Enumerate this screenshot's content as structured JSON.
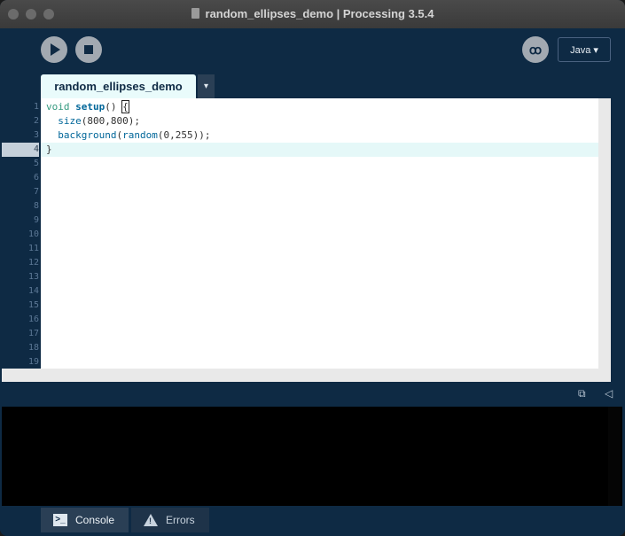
{
  "window": {
    "title": "random_ellipses_demo | Processing 3.5.4"
  },
  "toolbar": {
    "run_icon": "play-icon",
    "stop_icon": "stop-icon",
    "debug_icon": "butterfly-icon",
    "mode_label": "Java ▾"
  },
  "tabs": [
    {
      "label": "random_ellipses_demo"
    }
  ],
  "tab_menu": "▾",
  "editor": {
    "line_numbers": [
      "1",
      "2",
      "3",
      "4",
      "5",
      "6",
      "7",
      "8",
      "9",
      "10",
      "11",
      "12",
      "13",
      "14",
      "15",
      "16",
      "17",
      "18",
      "19"
    ],
    "active_line": "4",
    "code": {
      "l1_kw": "void",
      "l1_fn": "setup",
      "l1_rest": "() ",
      "l1_brace": "{",
      "l2_fn": "size",
      "l2_rest": "(800,800);",
      "l3_fn": "background",
      "l3_mid": "(",
      "l3_fn2": "random",
      "l3_rest": "(0,255));",
      "l4": "}"
    }
  },
  "footer": {
    "console_label": "Console",
    "errors_label": "Errors"
  },
  "colors": {
    "background": "#0e2a44",
    "editor": "#ffffff",
    "active_line": "#e5f8f8",
    "keyword": "#33997e",
    "function": "#006699"
  }
}
